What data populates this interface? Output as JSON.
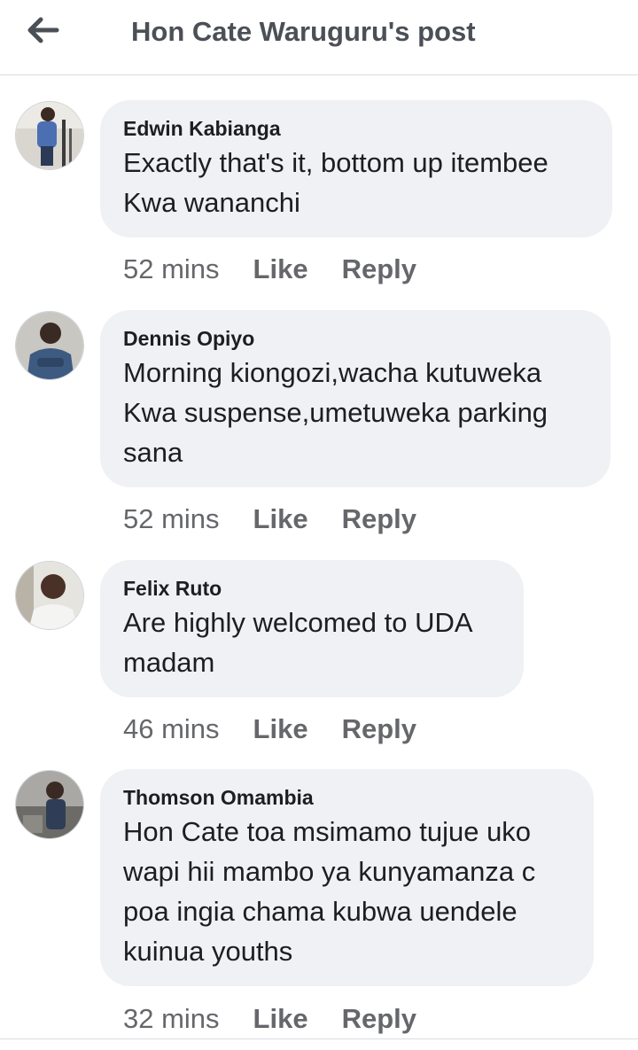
{
  "header": {
    "back_icon": "arrow-left-icon",
    "title": "Hon Cate Waruguru's post"
  },
  "comments": [
    {
      "author": "Edwin Kabianga",
      "text": "Exactly that's it, bottom up itembee Kwa wananchi",
      "time": "52 mins",
      "like": "Like",
      "reply": "Reply"
    },
    {
      "author": "Dennis Opiyo",
      "text": "Morning kiongozi,wacha kutuweka Kwa suspense,umetuweka parking sana",
      "time": "52 mins",
      "like": "Like",
      "reply": "Reply"
    },
    {
      "author": "Felix Ruto",
      "text": "Are highly welcomed to UDA madam",
      "time": "46 mins",
      "like": "Like",
      "reply": "Reply"
    },
    {
      "author": "Thomson Omambia",
      "text": "Hon Cate toa msimamo tujue uko wapi hii mambo ya kunyamanza c poa ingia chama kubwa uendele kuinua youths",
      "time": "32 mins",
      "like": "Like",
      "reply": "Reply"
    }
  ],
  "colors": {
    "bubble": "#f0f1f4",
    "meta": "#65676b",
    "title": "#4b4f56"
  }
}
